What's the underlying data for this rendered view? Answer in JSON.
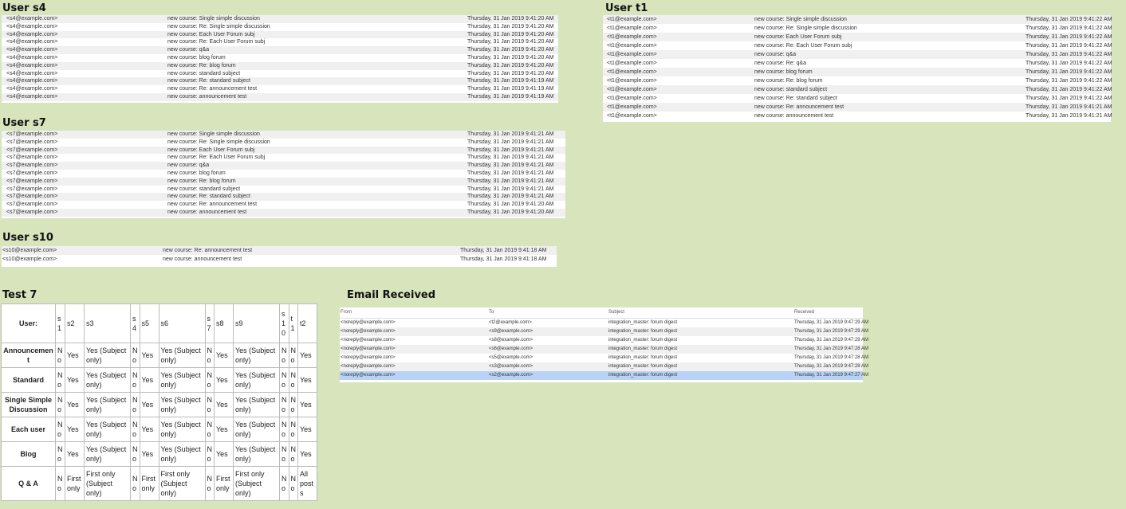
{
  "sections": {
    "s4": {
      "title": "User s4"
    },
    "t1": {
      "title": "User t1"
    },
    "s7": {
      "title": "User s7"
    },
    "s10": {
      "title": "User s10"
    },
    "test7": {
      "title": "Test 7"
    },
    "email": {
      "title": "Email Received"
    }
  },
  "mailboxes": {
    "s4": [
      {
        "from": "<s4@example.com>",
        "subject": "new course: Single simple discussion",
        "date": "Thursday, 31 Jan 2019 9:41:20 AM"
      },
      {
        "from": "<s4@example.com>",
        "subject": "new course: Re: Single simple discussion",
        "date": "Thursday, 31 Jan 2019 9:41:20 AM"
      },
      {
        "from": "<s4@example.com>",
        "subject": "new course: Each User Forum subj",
        "date": "Thursday, 31 Jan 2019 9:41:20 AM"
      },
      {
        "from": "<s4@example.com>",
        "subject": "new course: Re: Each User Forum subj",
        "date": "Thursday, 31 Jan 2019 9:41:20 AM"
      },
      {
        "from": "<s4@example.com>",
        "subject": "new course: q&a",
        "date": "Thursday, 31 Jan 2019 9:41:20 AM"
      },
      {
        "from": "<s4@example.com>",
        "subject": "new course: blog forum",
        "date": "Thursday, 31 Jan 2019 9:41:20 AM"
      },
      {
        "from": "<s4@example.com>",
        "subject": "new course: Re: blog forum",
        "date": "Thursday, 31 Jan 2019 9:41:20 AM"
      },
      {
        "from": "<s4@example.com>",
        "subject": "new course: standard subject",
        "date": "Thursday, 31 Jan 2019 9:41:20 AM"
      },
      {
        "from": "<s4@example.com>",
        "subject": "new course: Re: standard subject",
        "date": "Thursday, 31 Jan 2019 9:41:19 AM"
      },
      {
        "from": "<s4@example.com>",
        "subject": "new course: Re: announcement test",
        "date": "Thursday, 31 Jan 2019 9:41:19 AM"
      },
      {
        "from": "<s4@example.com>",
        "subject": "new course: announcement test",
        "date": "Thursday, 31 Jan 2019 9:41:19 AM"
      }
    ],
    "t1": [
      {
        "from": "<t1@example.com>",
        "subject": "new course: Single simple discussion",
        "date": "Thursday, 31 Jan 2019 9:41:22 AM"
      },
      {
        "from": "<t1@example.com>",
        "subject": "new course: Re: Single simple discussion",
        "date": "Thursday, 31 Jan 2019 9:41:22 AM"
      },
      {
        "from": "<t1@example.com>",
        "subject": "new course: Each User Forum subj",
        "date": "Thursday, 31 Jan 2019 9:41:22 AM"
      },
      {
        "from": "<t1@example.com>",
        "subject": "new course: Re: Each User Forum subj",
        "date": "Thursday, 31 Jan 2019 9:41:22 AM"
      },
      {
        "from": "<t1@example.com>",
        "subject": "new course: q&a",
        "date": "Thursday, 31 Jan 2019 9:41:22 AM"
      },
      {
        "from": "<t1@example.com>",
        "subject": "new course: Re: q&a",
        "date": "Thursday, 31 Jan 2019 9:41:22 AM"
      },
      {
        "from": "<t1@example.com>",
        "subject": "new course: blog forum",
        "date": "Thursday, 31 Jan 2019 9:41:22 AM"
      },
      {
        "from": "<t1@example.com>",
        "subject": "new course: Re: blog forum",
        "date": "Thursday, 31 Jan 2019 9:41:22 AM"
      },
      {
        "from": "<t1@example.com>",
        "subject": "new course: standard subject",
        "date": "Thursday, 31 Jan 2019 9:41:22 AM"
      },
      {
        "from": "<t1@example.com>",
        "subject": "new course: Re: standard subject",
        "date": "Thursday, 31 Jan 2019 9:41:22 AM"
      },
      {
        "from": "<t1@example.com>",
        "subject": "new course: Re: announcement test",
        "date": "Thursday, 31 Jan 2019 9:41:21 AM"
      },
      {
        "from": "<t1@example.com>",
        "subject": "new course: announcement test",
        "date": "Thursday, 31 Jan 2019 9:41:21 AM"
      }
    ],
    "s7": [
      {
        "from": "<s7@example.com>",
        "subject": "new course: Single simple discussion",
        "date": "Thursday, 31 Jan 2019 9:41:21 AM"
      },
      {
        "from": "<s7@example.com>",
        "subject": "new course: Re: Single simple discussion",
        "date": "Thursday, 31 Jan 2019 9:41:21 AM"
      },
      {
        "from": "<s7@example.com>",
        "subject": "new course: Each User Forum subj",
        "date": "Thursday, 31 Jan 2019 9:41:21 AM"
      },
      {
        "from": "<s7@example.com>",
        "subject": "new course: Re: Each User Forum subj",
        "date": "Thursday, 31 Jan 2019 9:41:21 AM"
      },
      {
        "from": "<s7@example.com>",
        "subject": "new course: q&a",
        "date": "Thursday, 31 Jan 2019 9:41:21 AM"
      },
      {
        "from": "<s7@example.com>",
        "subject": "new course: blog forum",
        "date": "Thursday, 31 Jan 2019 9:41:21 AM"
      },
      {
        "from": "<s7@example.com>",
        "subject": "new course: Re: blog forum",
        "date": "Thursday, 31 Jan 2019 9:41:21 AM"
      },
      {
        "from": "<s7@example.com>",
        "subject": "new course: standard subject",
        "date": "Thursday, 31 Jan 2019 9:41:21 AM"
      },
      {
        "from": "<s7@example.com>",
        "subject": "new course: Re: standard subject",
        "date": "Thursday, 31 Jan 2019 9:41:21 AM"
      },
      {
        "from": "<s7@example.com>",
        "subject": "new course: Re: announcement test",
        "date": "Thursday, 31 Jan 2019 9:41:20 AM"
      },
      {
        "from": "<s7@example.com>",
        "subject": "new course: announcement test",
        "date": "Thursday, 31 Jan 2019 9:41:20 AM"
      }
    ],
    "s10": [
      {
        "from": "<s10@example.com>",
        "subject": "new course: Re: announcement test",
        "date": "Thursday, 31 Jan 2019 9:41:18 AM"
      },
      {
        "from": "<s10@example.com>",
        "subject": "new course: announcement test",
        "date": "Thursday, 31 Jan 2019 9:41:18 AM"
      }
    ]
  },
  "email_received": {
    "headers": [
      "From",
      "To",
      "Subject",
      "Received"
    ],
    "rows": [
      {
        "from": "<noreply@example.com>",
        "to": "<t2@example.com>",
        "subject": "integration_master: forum digest",
        "received": "Thursday, 31 Jan 2019 9:47:29 AM"
      },
      {
        "from": "<noreply@example.com>",
        "to": "<s9@example.com>",
        "subject": "integration_master: forum digest",
        "received": "Thursday, 31 Jan 2019 9:47:29 AM"
      },
      {
        "from": "<noreply@example.com>",
        "to": "<s8@example.com>",
        "subject": "integration_master: forum digest",
        "received": "Thursday, 31 Jan 2019 9:47:29 AM"
      },
      {
        "from": "<noreply@example.com>",
        "to": "<s6@example.com>",
        "subject": "integration_master: forum digest",
        "received": "Thursday, 31 Jan 2019 9:47:28 AM"
      },
      {
        "from": "<noreply@example.com>",
        "to": "<s5@example.com>",
        "subject": "integration_master: forum digest",
        "received": "Thursday, 31 Jan 2019 9:47:28 AM"
      },
      {
        "from": "<noreply@example.com>",
        "to": "<s3@example.com>",
        "subject": "integration_master: forum digest",
        "received": "Thursday, 31 Jan 2019 9:47:28 AM"
      },
      {
        "from": "<noreply@example.com>",
        "to": "<s2@example.com>",
        "subject": "integration_master: forum digest",
        "received": "Thursday, 31 Jan 2019 9:47:27 AM",
        "selected": true
      }
    ]
  },
  "test7": {
    "header": [
      "User:",
      "s1",
      "s2",
      "s3",
      "s4",
      "s5",
      "s6",
      "s7",
      "s8",
      "s9",
      "s10",
      "t1",
      "t2"
    ],
    "rows": [
      {
        "label": "Announcement",
        "cells": [
          "No",
          "Yes",
          "Yes (Subject only)",
          "No",
          "Yes",
          "Yes (Subject only)",
          "No",
          "Yes",
          "Yes (Subject only)",
          "No",
          "No",
          "Yes"
        ]
      },
      {
        "label": "Standard",
        "cells": [
          "No",
          "Yes",
          "Yes (Subject only)",
          "No",
          "Yes",
          "Yes (Subject only)",
          "No",
          "Yes",
          "Yes (Subject only)",
          "No",
          "No",
          "Yes"
        ]
      },
      {
        "label": "Single Simple Discussion",
        "cells": [
          "No",
          "Yes",
          "Yes (Subject only)",
          "No",
          "Yes",
          "Yes (Subject only)",
          "No",
          "Yes",
          "Yes (Subject only)",
          "No",
          "No",
          "Yes"
        ]
      },
      {
        "label": "Each user",
        "cells": [
          "No",
          "Yes",
          "Yes (Subject only)",
          "No",
          "Yes",
          "Yes (Subject only)",
          "No",
          "Yes",
          "Yes (Subject only)",
          "No",
          "No",
          "Yes"
        ]
      },
      {
        "label": "Blog",
        "cells": [
          "No",
          "Yes",
          "Yes (Subject only)",
          "No",
          "Yes",
          "Yes (Subject only)",
          "No",
          "Yes",
          "Yes (Subject only)",
          "No",
          "No",
          "Yes"
        ]
      },
      {
        "label": "Q & A",
        "cells": [
          "No",
          "First only",
          "First only (Subject only)",
          "No",
          "First only",
          "First only (Subject only)",
          "No",
          "First only",
          "First only (Subject only)",
          "No",
          "No",
          "All posts"
        ]
      }
    ]
  }
}
